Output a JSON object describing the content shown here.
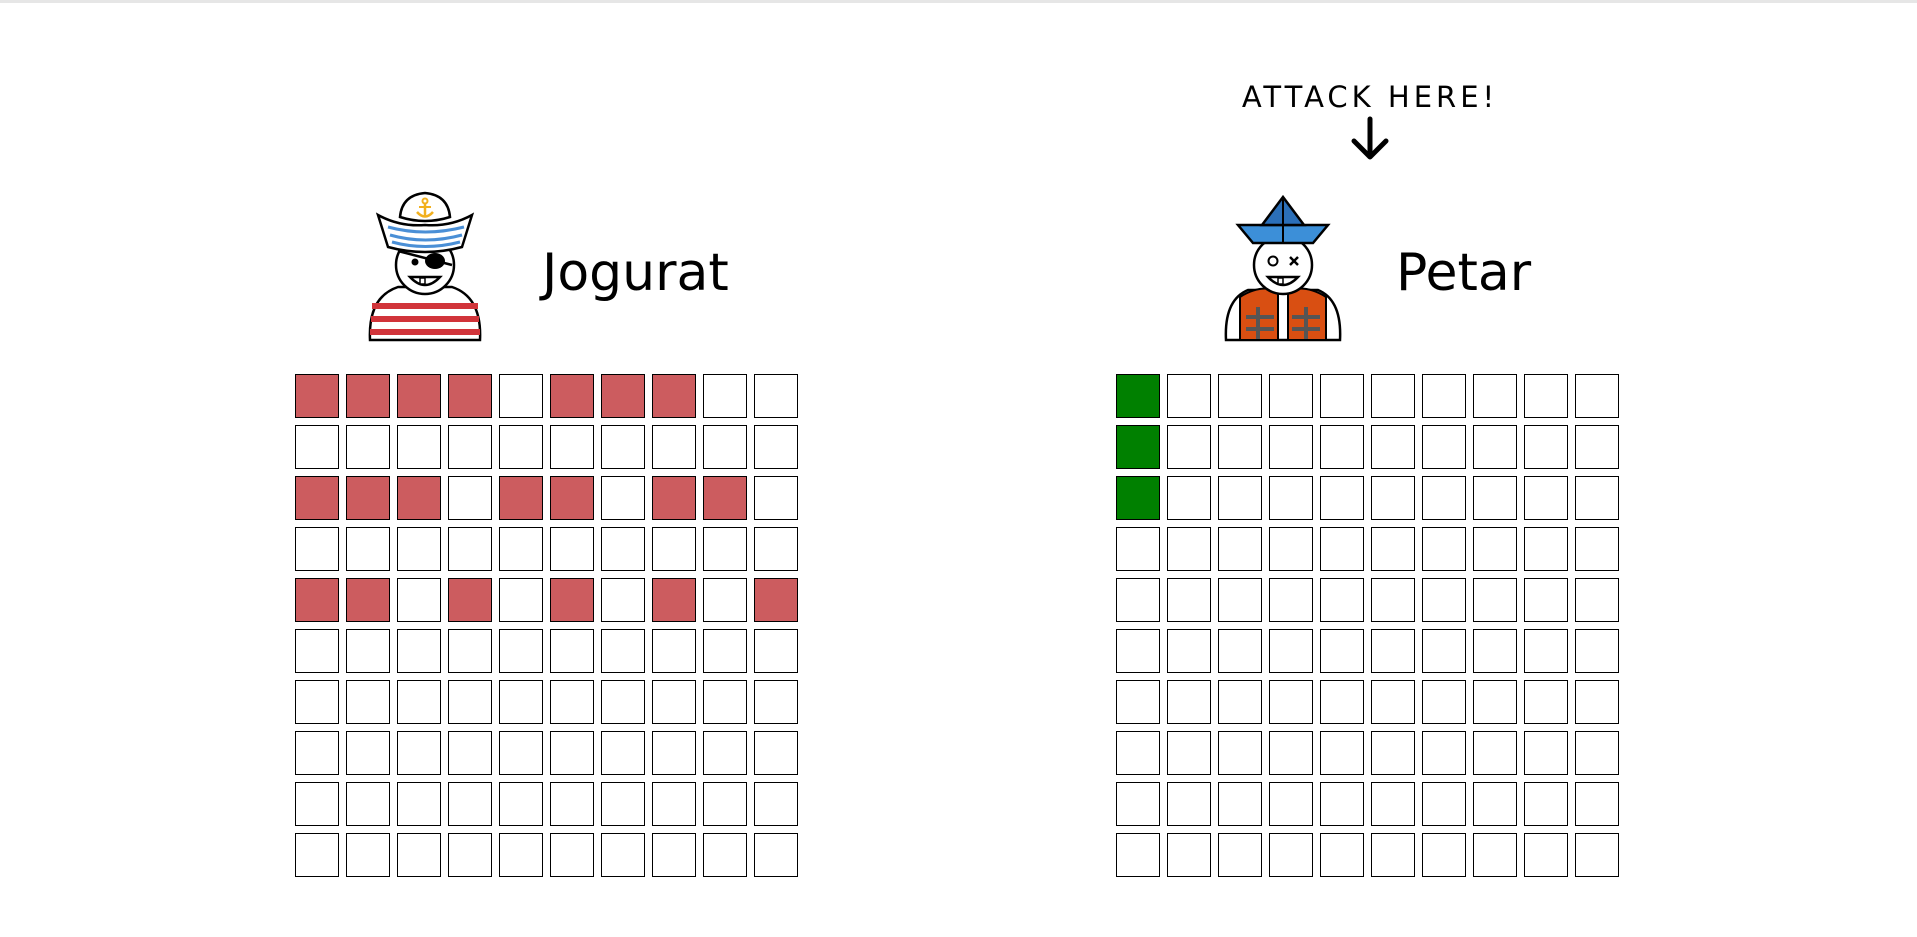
{
  "attack_prompt": "ATTACK HERE!",
  "colors": {
    "hit": "#cc5c5f",
    "ship": "#008000",
    "empty": "#ffffff",
    "border": "#000000"
  },
  "players": [
    {
      "name": "Jogurat",
      "avatar_icon": "pirate-sailor-avatar-icon",
      "board_role": "own",
      "grid": [
        [
          "hit",
          "hit",
          "hit",
          "hit",
          "empty",
          "hit",
          "hit",
          "hit",
          "empty",
          "empty"
        ],
        [
          "empty",
          "empty",
          "empty",
          "empty",
          "empty",
          "empty",
          "empty",
          "empty",
          "empty",
          "empty"
        ],
        [
          "hit",
          "hit",
          "hit",
          "empty",
          "hit",
          "hit",
          "empty",
          "hit",
          "hit",
          "empty"
        ],
        [
          "empty",
          "empty",
          "empty",
          "empty",
          "empty",
          "empty",
          "empty",
          "empty",
          "empty",
          "empty"
        ],
        [
          "hit",
          "hit",
          "empty",
          "hit",
          "empty",
          "hit",
          "empty",
          "hit",
          "empty",
          "hit"
        ],
        [
          "empty",
          "empty",
          "empty",
          "empty",
          "empty",
          "empty",
          "empty",
          "empty",
          "empty",
          "empty"
        ],
        [
          "empty",
          "empty",
          "empty",
          "empty",
          "empty",
          "empty",
          "empty",
          "empty",
          "empty",
          "empty"
        ],
        [
          "empty",
          "empty",
          "empty",
          "empty",
          "empty",
          "empty",
          "empty",
          "empty",
          "empty",
          "empty"
        ],
        [
          "empty",
          "empty",
          "empty",
          "empty",
          "empty",
          "empty",
          "empty",
          "empty",
          "empty",
          "empty"
        ],
        [
          "empty",
          "empty",
          "empty",
          "empty",
          "empty",
          "empty",
          "empty",
          "empty",
          "empty",
          "empty"
        ]
      ]
    },
    {
      "name": "Petar",
      "avatar_icon": "lifejacket-sailor-avatar-icon",
      "board_role": "enemy",
      "grid": [
        [
          "ship",
          "empty",
          "empty",
          "empty",
          "empty",
          "empty",
          "empty",
          "empty",
          "empty",
          "empty"
        ],
        [
          "ship",
          "empty",
          "empty",
          "empty",
          "empty",
          "empty",
          "empty",
          "empty",
          "empty",
          "empty"
        ],
        [
          "ship",
          "empty",
          "empty",
          "empty",
          "empty",
          "empty",
          "empty",
          "empty",
          "empty",
          "empty"
        ],
        [
          "empty",
          "empty",
          "empty",
          "empty",
          "empty",
          "empty",
          "empty",
          "empty",
          "empty",
          "empty"
        ],
        [
          "empty",
          "empty",
          "empty",
          "empty",
          "empty",
          "empty",
          "empty",
          "empty",
          "empty",
          "empty"
        ],
        [
          "empty",
          "empty",
          "empty",
          "empty",
          "empty",
          "empty",
          "empty",
          "empty",
          "empty",
          "empty"
        ],
        [
          "empty",
          "empty",
          "empty",
          "empty",
          "empty",
          "empty",
          "empty",
          "empty",
          "empty",
          "empty"
        ],
        [
          "empty",
          "empty",
          "empty",
          "empty",
          "empty",
          "empty",
          "empty",
          "empty",
          "empty",
          "empty"
        ],
        [
          "empty",
          "empty",
          "empty",
          "empty",
          "empty",
          "empty",
          "empty",
          "empty",
          "empty",
          "empty"
        ],
        [
          "empty",
          "empty",
          "empty",
          "empty",
          "empty",
          "empty",
          "empty",
          "empty",
          "empty",
          "empty"
        ]
      ]
    }
  ]
}
